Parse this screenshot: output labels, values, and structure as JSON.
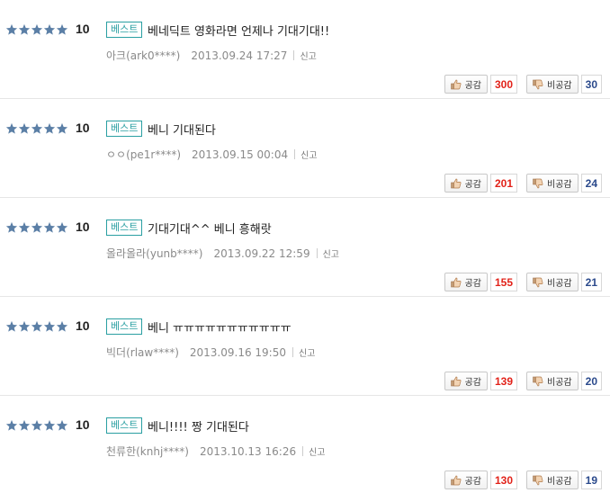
{
  "colors": {
    "star": "#5b7fa6",
    "badge": "#2a9fa2",
    "like_count": "#e2231a",
    "dislike_count": "#2b4a8c"
  },
  "icons": {
    "star": "star-icon",
    "like": "thumbs-up-icon",
    "dislike": "thumbs-down-icon"
  },
  "labels": {
    "badge": "베스트",
    "report": "신고",
    "like": "공감",
    "dislike": "비공감"
  },
  "reviews": [
    {
      "stars": 5,
      "score": "10",
      "text": "베네딕트 영화라면 언제나 기대기대!!",
      "author": "아크(ark0****)",
      "date": "2013.09.24 17:27",
      "likes": "300",
      "dislikes": "30"
    },
    {
      "stars": 5,
      "score": "10",
      "text": "베니 기대된다",
      "author": "ㅇㅇ(pe1r****)",
      "date": "2013.09.15 00:04",
      "likes": "201",
      "dislikes": "24"
    },
    {
      "stars": 5,
      "score": "10",
      "text": "기대기대^^ 베니 흥해랏",
      "author": "올라올라(yunb****)",
      "date": "2013.09.22 12:59",
      "likes": "155",
      "dislikes": "21"
    },
    {
      "stars": 5,
      "score": "10",
      "text": "베니 ㅠㅠㅠㅠㅠㅠㅠㅠㅠㅠㅠ",
      "author": "빅더(rlaw****)",
      "date": "2013.09.16 19:50",
      "likes": "139",
      "dislikes": "20"
    },
    {
      "stars": 5,
      "score": "10",
      "text": "베니!!!! 짱 기대된다",
      "author": "천류한(knhj****)",
      "date": "2013.10.13 16:26",
      "likes": "130",
      "dislikes": "19"
    }
  ]
}
